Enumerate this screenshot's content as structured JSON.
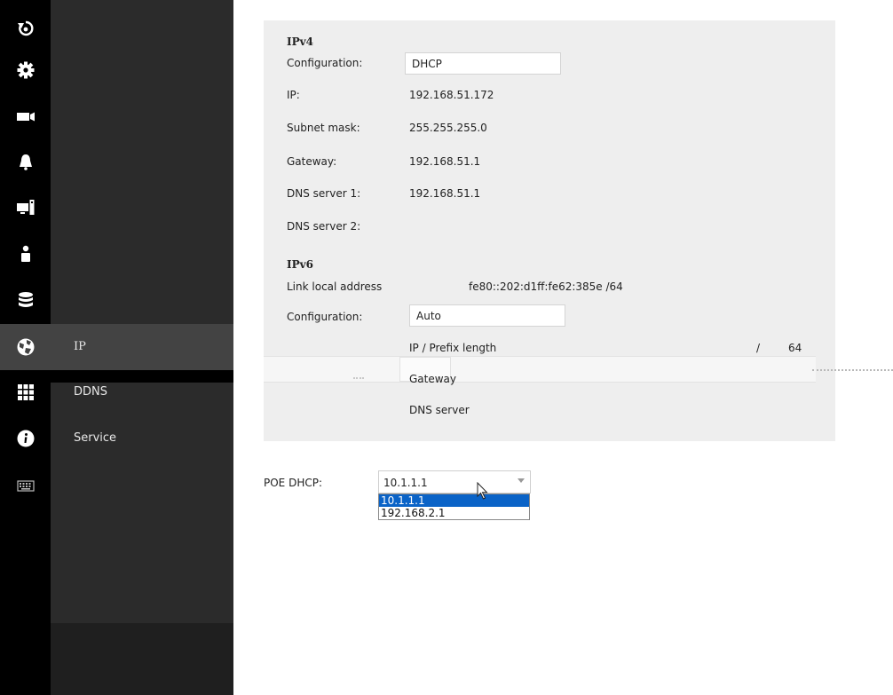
{
  "sidebar": {
    "icons": [
      "home-back-icon",
      "gear-icon",
      "camera-icon",
      "bell-icon",
      "display-icon",
      "user-icon",
      "storage-icon",
      "network-icon",
      "apps-grid-icon",
      "info-icon",
      "keyboard-icon"
    ],
    "submenu": {
      "items": [
        {
          "label": "IP"
        },
        {
          "label": "DDNS"
        },
        {
          "label": "Service"
        }
      ],
      "active": "IP"
    },
    "colors": {
      "rail": "#000000",
      "panel": "#2b2b2b",
      "active": "#434343"
    }
  },
  "ipv4": {
    "heading": "IPv4",
    "configuration_label": "Configuration:",
    "configuration_value": "DHCP",
    "ip_label": "IP:",
    "ip_value": "192.168.51.172",
    "subnet_label": "Subnet mask:",
    "subnet_value": "255.255.255.0",
    "gateway_label": "Gateway:",
    "gateway_value": "192.168.51.1",
    "dns1_label": "DNS server 1:",
    "dns1_value": "192.168.51.1",
    "dns2_label": "DNS server 2:"
  },
  "ipv6": {
    "heading": "IPv6",
    "link_local_label": "Link local address",
    "link_local_value": "fe80::202:d1ff:fe62:385e /64",
    "configuration_label": "Configuration:",
    "configuration_value": "Auto",
    "prefix_label": "IP / Prefix length",
    "prefix_sep": "/",
    "prefix_value": "64",
    "gateway_label": "Gateway",
    "dns_label": "DNS server"
  },
  "poe": {
    "label": "POE DHCP:",
    "selected": "10.1.1.1",
    "options": [
      "10.1.1.1",
      "192.168.2.1"
    ],
    "highlight_color": "#0a63c7"
  }
}
